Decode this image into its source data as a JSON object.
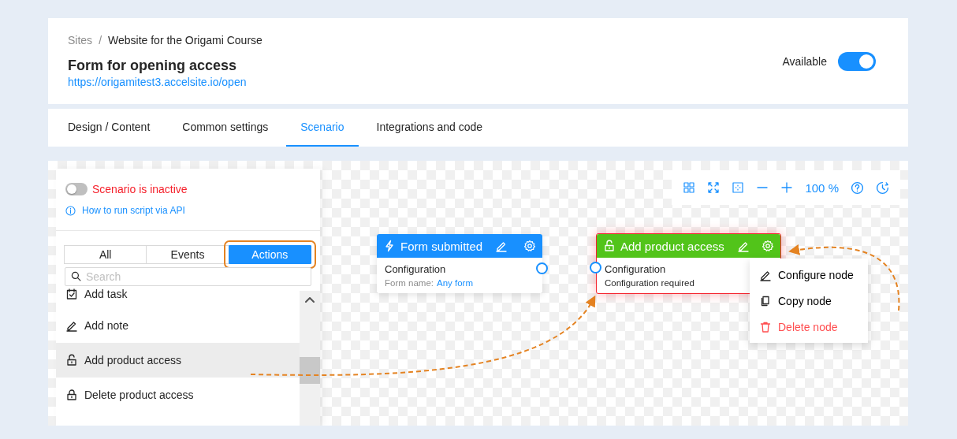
{
  "header": {
    "breadcrumb": [
      "Sites",
      "Website for the Origami Course"
    ],
    "separator": "/",
    "title": "Form for opening access",
    "url": "https://origamitest3.accelsite.io/open",
    "available": {
      "label": "Available",
      "on": true
    }
  },
  "tabs": [
    {
      "label": "Design / Content",
      "selected": false
    },
    {
      "label": "Common settings",
      "selected": false
    },
    {
      "label": "Scenario",
      "selected": true
    },
    {
      "label": "Integrations and code",
      "selected": false
    }
  ],
  "panel": {
    "scenario": {
      "on": false,
      "label": "Scenario is inactive"
    },
    "help_link": "How to run script via API",
    "filters": [
      {
        "label": "All",
        "selected": false
      },
      {
        "label": "Events",
        "selected": false
      },
      {
        "label": "Actions",
        "selected": true
      }
    ],
    "search": {
      "placeholder": "Search"
    },
    "items": [
      {
        "kind": "task",
        "label": "Add task",
        "selected": false
      },
      {
        "kind": "note",
        "label": "Add note",
        "selected": false
      },
      {
        "kind": "unlock",
        "label": "Add product access",
        "selected": true
      },
      {
        "kind": "lock",
        "label": "Delete product access",
        "selected": false
      }
    ]
  },
  "toolbar": {
    "zoom": "100 %"
  },
  "nodes": [
    {
      "kind": "event",
      "title": "Form submitted",
      "invalid": false,
      "line1": "Configuration",
      "line2_label": "Form name:",
      "line2_value": "Any form"
    },
    {
      "kind": "action",
      "title": "Add product access",
      "invalid": true,
      "line1": "Configuration",
      "line2_label": "Configuration required"
    }
  ],
  "context_menu": [
    {
      "kind": "configure",
      "label": "Configure node"
    },
    {
      "kind": "copy",
      "label": "Copy node"
    },
    {
      "kind": "delete",
      "label": "Delete node"
    }
  ]
}
